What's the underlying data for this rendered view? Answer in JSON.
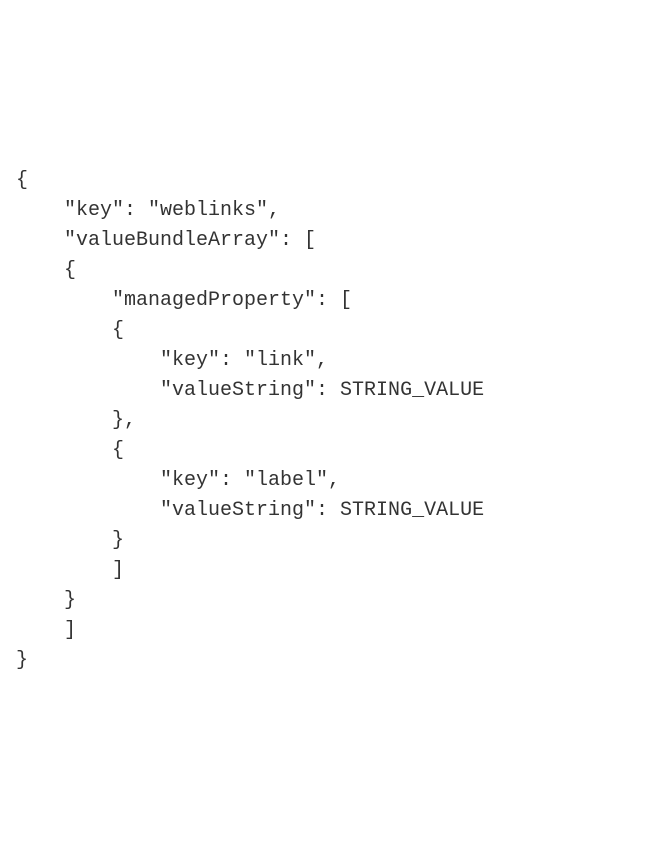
{
  "code": {
    "line1": "{",
    "line2": "    \"key\": \"weblinks\",",
    "line3": "    \"valueBundleArray\": [",
    "line4": "    {",
    "line5": "        \"managedProperty\": [",
    "line6": "        {",
    "line7": "            \"key\": \"link\",",
    "line8": "            \"valueString\": STRING_VALUE",
    "line9": "        },",
    "line10": "        {",
    "line11": "            \"key\": \"label\",",
    "line12": "            \"valueString\": STRING_VALUE",
    "line13": "        }",
    "line14": "        ]",
    "line15": "    }",
    "line16": "    ]",
    "line17": "}"
  }
}
